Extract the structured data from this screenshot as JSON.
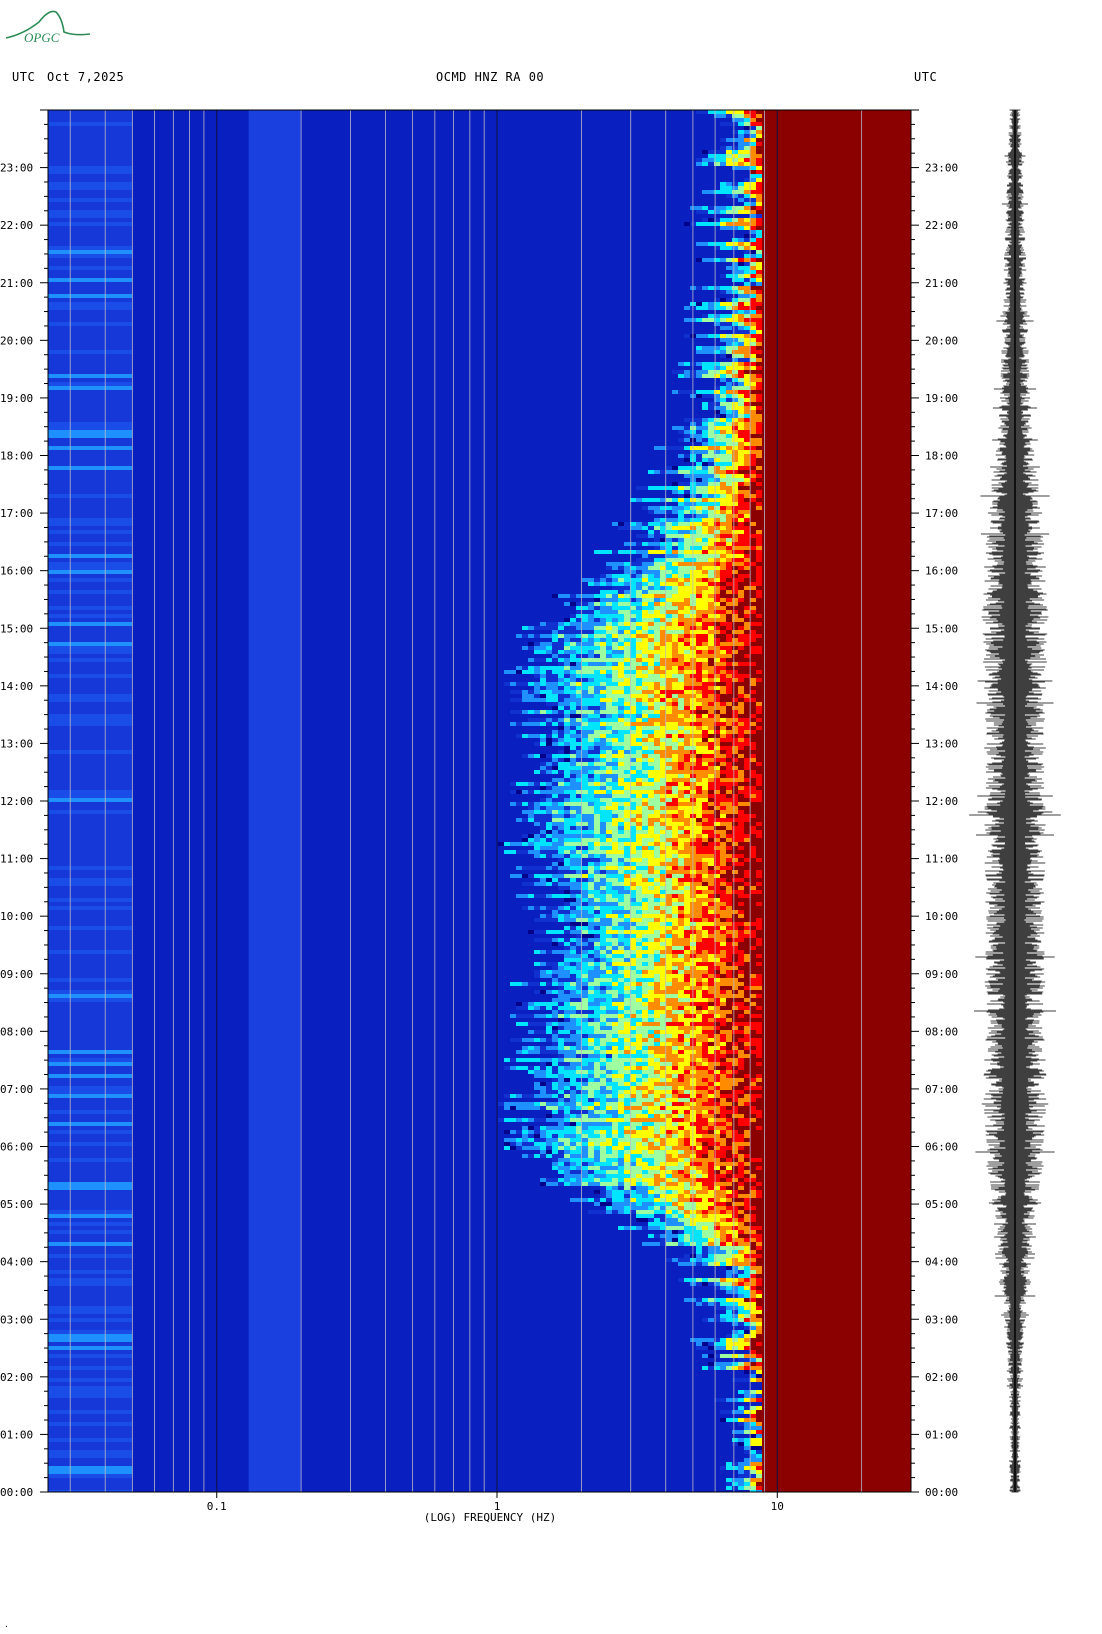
{
  "header": {
    "left_utc": "UTC",
    "date": "Oct 7,2025",
    "channel": "OCMD HNZ RA 00",
    "right_utc": "UTC"
  },
  "logo": {
    "text": "OPGC",
    "color": "#2e8b57"
  },
  "chart_data": {
    "type": "heatmap",
    "title": "OCMD HNZ RA 00",
    "xlabel": "(LOG) FREQUENCY (HZ)",
    "x_scale": "log",
    "xlim": [
      0.025,
      30
    ],
    "x_ticks": [
      {
        "value": 0.1,
        "label": "0.1"
      },
      {
        "value": 1,
        "label": "1"
      },
      {
        "value": 10,
        "label": "10"
      }
    ],
    "x_gridlines": [
      0.03,
      0.04,
      0.05,
      0.06,
      0.07,
      0.08,
      0.09,
      0.1,
      0.2,
      0.3,
      0.4,
      0.5,
      0.6,
      0.7,
      0.8,
      0.9,
      1,
      2,
      3,
      4,
      5,
      6,
      7,
      8,
      9,
      10,
      20
    ],
    "ylabel": "UTC",
    "ylim_hours": [
      0,
      24
    ],
    "y_ticks": [
      "00:00",
      "01:00",
      "02:00",
      "03:00",
      "04:00",
      "05:00",
      "06:00",
      "07:00",
      "08:00",
      "09:00",
      "10:00",
      "11:00",
      "12:00",
      "13:00",
      "14:00",
      "15:00",
      "16:00",
      "17:00",
      "18:00",
      "19:00",
      "20:00",
      "21:00",
      "22:00",
      "23:00"
    ],
    "colormap": [
      "#00008b",
      "#1030d0",
      "#1e90ff",
      "#00e5ff",
      "#9effa0",
      "#ffff00",
      "#ff8c00",
      "#ff0000",
      "#8b0000"
    ],
    "activity_by_hour": [
      {
        "hour": 0,
        "onset_hz": 8
      },
      {
        "hour": 1,
        "onset_hz": 8
      },
      {
        "hour": 2,
        "onset_hz": 8
      },
      {
        "hour": 3,
        "onset_hz": 7
      },
      {
        "hour": 4,
        "onset_hz": 6
      },
      {
        "hour": 5,
        "onset_hz": 2.5
      },
      {
        "hour": 6,
        "onset_hz": 1.5
      },
      {
        "hour": 7,
        "onset_hz": 1.5
      },
      {
        "hour": 8,
        "onset_hz": 1.5
      },
      {
        "hour": 9,
        "onset_hz": 1.6
      },
      {
        "hour": 10,
        "onset_hz": 1.8
      },
      {
        "hour": 11,
        "onset_hz": 1.5
      },
      {
        "hour": 12,
        "onset_hz": 1.5
      },
      {
        "hour": 13,
        "onset_hz": 1.6
      },
      {
        "hour": 14,
        "onset_hz": 1.5
      },
      {
        "hour": 15,
        "onset_hz": 1.5
      },
      {
        "hour": 16,
        "onset_hz": 3
      },
      {
        "hour": 17,
        "onset_hz": 4
      },
      {
        "hour": 18,
        "onset_hz": 5
      },
      {
        "hour": 19,
        "onset_hz": 6
      },
      {
        "hour": 20,
        "onset_hz": 6.5
      },
      {
        "hour": 21,
        "onset_hz": 7
      },
      {
        "hour": 22,
        "onset_hz": 7
      },
      {
        "hour": 23,
        "onset_hz": 7.5
      },
      {
        "hour": 24,
        "onset_hz": 7.5
      }
    ],
    "seismogram_amplitude_by_hour": [
      0.15,
      0.15,
      0.15,
      0.3,
      0.5,
      0.6,
      0.8,
      0.85,
      0.8,
      0.8,
      0.75,
      0.8,
      0.8,
      0.75,
      0.8,
      0.85,
      0.8,
      0.7,
      0.5,
      0.4,
      0.35,
      0.3,
      0.25,
      0.2,
      0.15
    ]
  }
}
